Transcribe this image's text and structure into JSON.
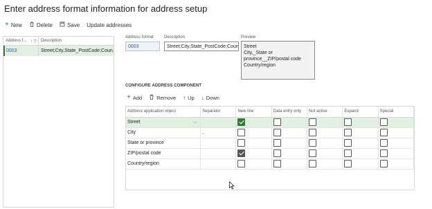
{
  "page": {
    "title": "Enter address format information for address setup"
  },
  "toolbar": {
    "new_label": "New",
    "delete_label": "Delete",
    "save_label": "Save",
    "update_label": "Update addresses"
  },
  "list": {
    "col_format": "Address f...",
    "col_description": "Description",
    "rows": [
      {
        "format": "0003",
        "description": "Street;City,State_PostCode;Coun..."
      }
    ]
  },
  "form": {
    "format_label": "Address format",
    "format_value": "0003",
    "description_label": "Description",
    "description_value": "Street;City,State_PostCode;Coun...",
    "preview_label": "Preview",
    "preview_lines": [
      "Street",
      "City,_State or",
      "province__ZIP/postal code",
      "Country/region"
    ]
  },
  "components": {
    "section_title": "CONFIGURE ADDRESS COMPONENT",
    "add_label": "Add",
    "remove_label": "Remove",
    "up_label": "Up",
    "down_label": "Down",
    "columns": [
      "Address application object",
      "Separator",
      "New line",
      "Data entry only",
      "Not active",
      "Expand",
      "Special"
    ],
    "rows": [
      {
        "object": "Street",
        "separator": "",
        "new_line": true,
        "data_entry_only": false,
        "not_active": false,
        "expand": false,
        "special": false
      },
      {
        "object": "City",
        "separator": ",",
        "new_line": false,
        "data_entry_only": false,
        "not_active": false,
        "expand": false,
        "special": false
      },
      {
        "object": "State or province",
        "separator": "",
        "new_line": false,
        "data_entry_only": false,
        "not_active": false,
        "expand": false,
        "special": false
      },
      {
        "object": "ZIP/postal code",
        "separator": "",
        "new_line": true,
        "data_entry_only": false,
        "not_active": false,
        "expand": false,
        "special": false
      },
      {
        "object": "Country/region",
        "separator": "",
        "new_line": false,
        "data_entry_only": false,
        "not_active": false,
        "expand": false,
        "special": false
      }
    ]
  },
  "colors": {
    "accent": "#2e7d32",
    "selected_row": "#e1f0e1",
    "link": "#1a63b8"
  }
}
